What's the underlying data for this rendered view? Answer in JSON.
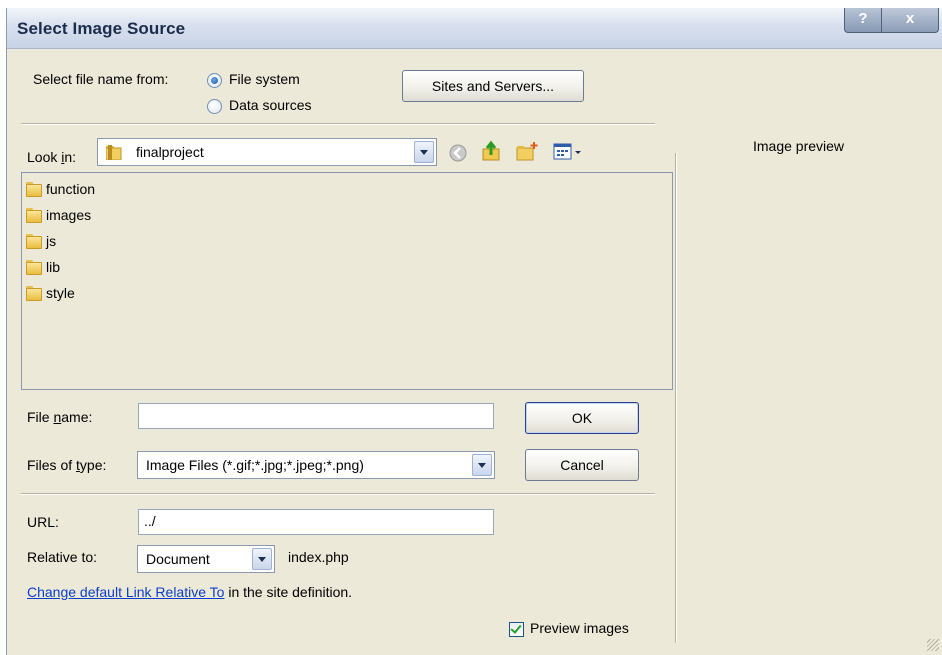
{
  "window": {
    "title": "Select Image Source",
    "help": "?",
    "close": "x"
  },
  "source": {
    "label": "Select file name from:",
    "options": [
      "File system",
      "Data sources"
    ],
    "selected": "File system",
    "sites_button": "Sites and Servers..."
  },
  "lookin": {
    "label_pre": "Look ",
    "label_key": "i",
    "label_post": "n:",
    "value": "finalproject"
  },
  "toolbar_icons": [
    "back-icon",
    "up-folder-icon",
    "new-folder-icon",
    "view-menu-icon"
  ],
  "files": [
    "function",
    "images",
    "js",
    "lib",
    "style"
  ],
  "filename": {
    "label_pre": "File ",
    "label_key": "n",
    "label_post": "ame:",
    "value": ""
  },
  "filetype": {
    "label_pre": "Files of ",
    "label_key": "t",
    "label_post": "ype:",
    "value": "Image Files (*.gif;*.jpg;*.jpeg;*.png)"
  },
  "buttons": {
    "ok": "OK",
    "cancel": "Cancel"
  },
  "url": {
    "label": "URL:",
    "value": "../"
  },
  "relative": {
    "label": "Relative to:",
    "value": "Document",
    "file": "index.php"
  },
  "change_link": {
    "text": "Change default Link Relative To",
    "suffix": " in the site definition."
  },
  "preview": {
    "checkbox_label": "Preview images",
    "checked": true,
    "title": "Image preview"
  }
}
